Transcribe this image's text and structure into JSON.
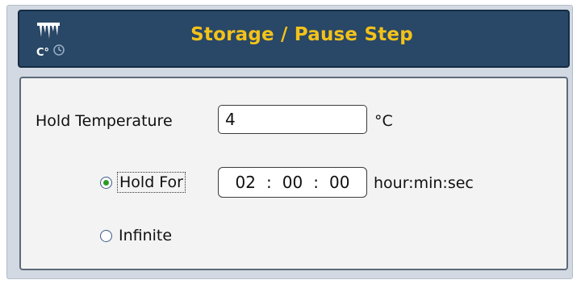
{
  "header": {
    "title": "Storage / Pause Step",
    "icon_text": "C°",
    "icon": "icicle-thermo-icon",
    "title_color": "#f3c21a",
    "bar_color": "#294766"
  },
  "form": {
    "hold_temperature_label": "Hold Temperature",
    "hold_temperature_value": "4",
    "temperature_unit": "°C",
    "hold_for_label": "Hold For",
    "hold_for_selected": true,
    "time": {
      "hours": "02",
      "minutes": "00",
      "seconds": "00",
      "separator": ":"
    },
    "time_format_label": "hour:min:sec",
    "infinite_label": "Infinite",
    "infinite_selected": false,
    "radio_selected_color": "#2c9a24"
  }
}
